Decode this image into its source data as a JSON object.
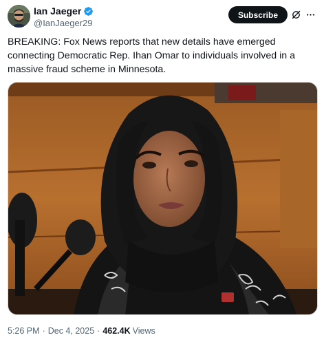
{
  "author": {
    "display_name": "Ian Jaeger",
    "handle": "@IanJaeger29",
    "verified": true
  },
  "actions": {
    "subscribe_label": "Subscribe",
    "grok_icon": "grok-icon",
    "more_icon": "more-icon"
  },
  "tweet": {
    "text": "BREAKING: Fox News reports that new details have emerged connecting Democratic Rep. Ihan Omar to individuals involved in a massive fraud scheme in Minnesota."
  },
  "media": {
    "type": "photo"
  },
  "meta": {
    "time": "5:26 PM",
    "separator": "·",
    "date": "Dec 4, 2025",
    "views_count": "462.4K",
    "views_label": "Views"
  },
  "colors": {
    "text": "#0f1419",
    "secondary": "#536471",
    "verified": "#1d9bf0",
    "button": "#0f1419"
  }
}
